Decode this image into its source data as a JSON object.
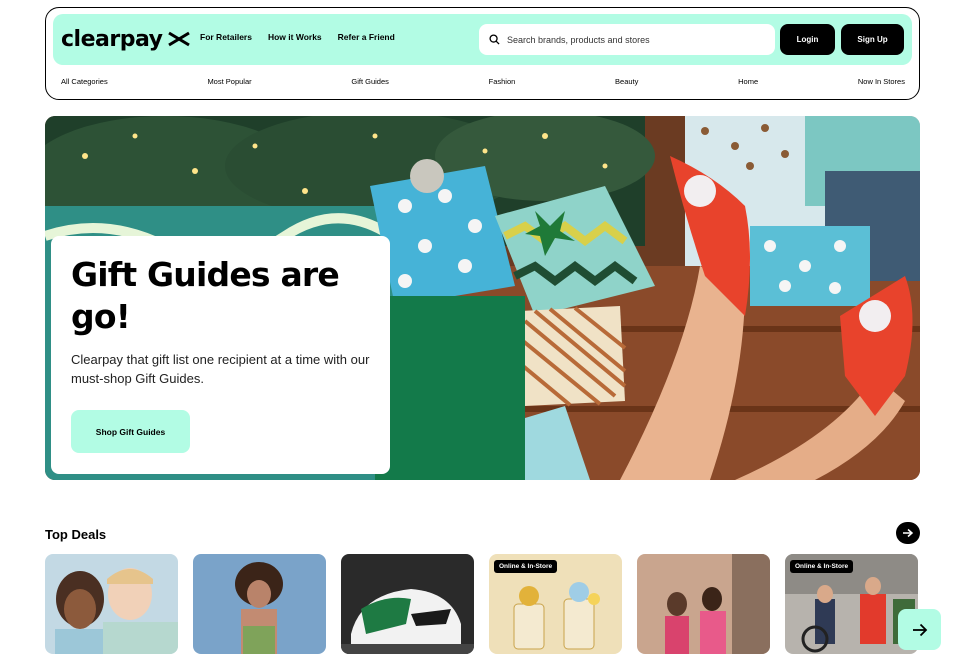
{
  "brand": {
    "logo_text": "clearpay",
    "accent": "#b2fce4"
  },
  "nav": {
    "links": [
      "For Retailers",
      "How it Works",
      "Refer a Friend"
    ]
  },
  "search": {
    "placeholder": "Search brands, products and stores",
    "value": ""
  },
  "auth": {
    "login_label": "Login",
    "signup_label": "Sign Up"
  },
  "categories": [
    "All Categories",
    "Most Popular",
    "Gift Guides",
    "Fashion",
    "Beauty",
    "Home",
    "Now In Stores"
  ],
  "hero": {
    "title": "Gift Guides are go!",
    "subtitle": "Clearpay that gift list one recipient at a time with our must-shop Gift Guides.",
    "cta_label": "Shop Gift Guides"
  },
  "top_deals": {
    "title": "Top Deals",
    "items": [
      {
        "badge": ""
      },
      {
        "badge": ""
      },
      {
        "badge": ""
      },
      {
        "badge": "Online & In-Store"
      },
      {
        "badge": ""
      },
      {
        "badge": "Online & In-Store"
      }
    ]
  },
  "icons": {
    "search": "search-icon",
    "next": "arrow-right-icon",
    "logo_mark": "clearpay-logo-icon"
  }
}
